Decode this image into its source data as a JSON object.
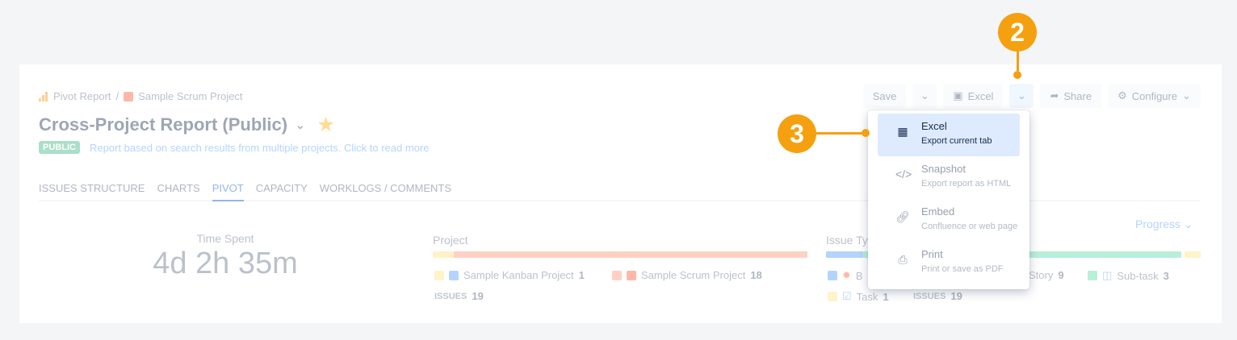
{
  "breadcrumb": {
    "root": "Pivot Report",
    "separator": "/",
    "project": "Sample Scrum Project"
  },
  "report": {
    "title": "Cross-Project Report (Public)",
    "badge": "PUBLIC",
    "description": "Report based on search results from multiple projects. Click to read more"
  },
  "toolbar": {
    "save": "Save",
    "excel": "Excel",
    "share": "Share",
    "configure": "Configure"
  },
  "tabs": [
    "ISSUES STRUCTURE",
    "CHARTS",
    "PIVOT",
    "CAPACITY",
    "WORKLOGS / COMMENTS"
  ],
  "metric": {
    "label": "Time Spent",
    "value": "4d 2h 35m"
  },
  "project_section": {
    "title": "Project",
    "items": [
      {
        "label": "Sample Kanban Project",
        "count": "1"
      },
      {
        "label": "Sample Scrum Project",
        "count": "18"
      }
    ],
    "issues_label": "ISSUES",
    "issues_count": "19"
  },
  "issue_type_section": {
    "title": "Issue Ty",
    "items": [
      {
        "label": "B",
        "count": ""
      },
      {
        "label": "Story",
        "count": "9"
      },
      {
        "label": "Sub-task",
        "count": "3"
      },
      {
        "label": "Task",
        "count": "1"
      }
    ],
    "issues_label": "ISSUES",
    "issues_count": "19",
    "progress_label": "Progress"
  },
  "menu": [
    {
      "title": "Excel",
      "subtitle": "Export current tab"
    },
    {
      "title": "Snapshot",
      "subtitle": "Export report as HTML"
    },
    {
      "title": "Embed",
      "subtitle": "Confluence or web page"
    },
    {
      "title": "Print",
      "subtitle": "Print or save as PDF"
    }
  ],
  "callouts": {
    "two": "2",
    "three": "3"
  },
  "colors": {
    "accent": "#f5a00f",
    "selected": "#deebff",
    "link": "#0052cc"
  }
}
